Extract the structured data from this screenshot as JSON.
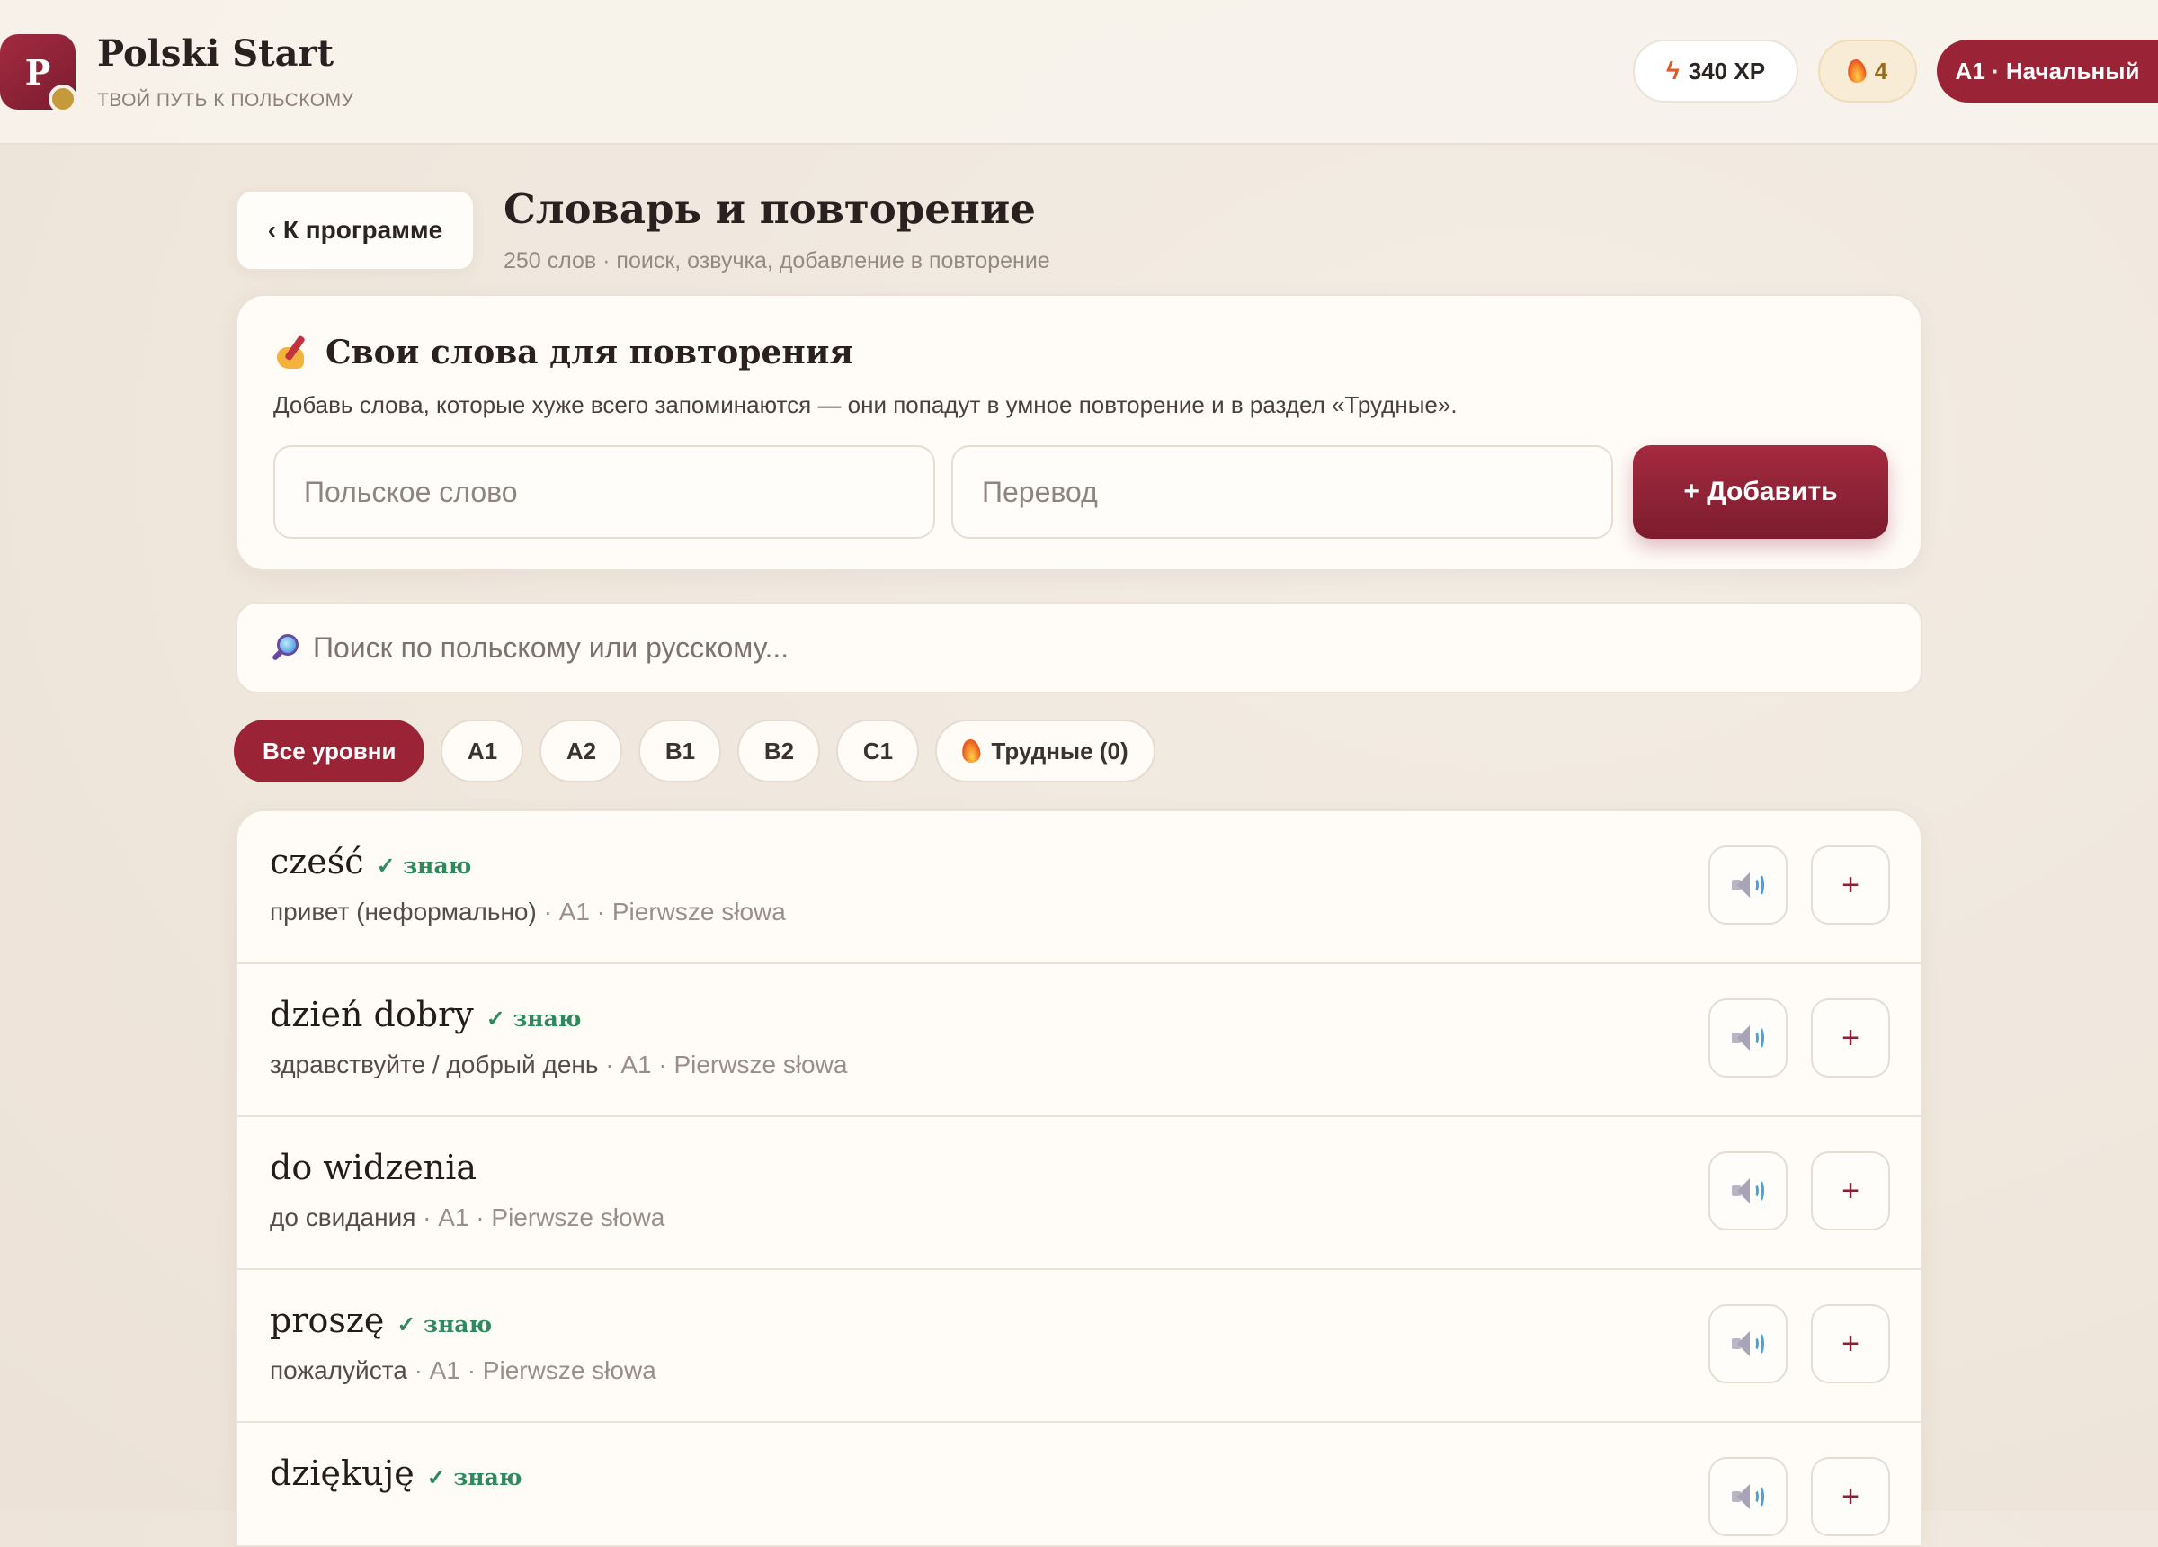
{
  "header": {
    "logo_letter": "P",
    "brand_title": "Polski Start",
    "brand_subtitle": "ТВОЙ ПУТЬ К ПОЛЬСКОМУ",
    "xp": "340 XP",
    "streak": "4",
    "level": "A1 · Начальный"
  },
  "page": {
    "back_label": "‹ К программе",
    "title": "Словарь и повторение",
    "subtitle": "250 слов · поиск, озвучка, добавление в повторение"
  },
  "add_card": {
    "title": "Свои слова для повторения",
    "description": "Добавь слова, которые хуже всего запоминаются — они попадут в умное повторение и в раздел «Трудные».",
    "polish_placeholder": "Польское слово",
    "translation_placeholder": "Перевод",
    "add_button": "+ Добавить"
  },
  "search": {
    "placeholder": "Поиск по польскому или русскому..."
  },
  "filters": {
    "all": "Все уровни",
    "levels": [
      "A1",
      "A2",
      "B1",
      "B2",
      "C1"
    ],
    "hard": "Трудные (0)"
  },
  "words": [
    {
      "word": "cześć",
      "known": "✓ знаю",
      "translation": "привет (неформально)",
      "info": " · A1 · Pierwsze słowa"
    },
    {
      "word": "dzień dobry",
      "known": "✓ знаю",
      "translation": "здравствуйте / добрый день",
      "info": " · A1 · Pierwsze słowa"
    },
    {
      "word": "do widzenia",
      "known": "",
      "translation": "до свидания",
      "info": " · A1 · Pierwsze słowa"
    },
    {
      "word": "proszę",
      "known": "✓ знаю",
      "translation": "пожалуйста",
      "info": " · A1 · Pierwsze słowa"
    },
    {
      "word": "dziękuję",
      "known": "✓ знаю",
      "translation": "",
      "info": ""
    }
  ],
  "buttons": {
    "plus": "+"
  },
  "colors": {
    "accent": "#9b2336",
    "known": "#2e8a5c",
    "background": "#efe6dc"
  }
}
